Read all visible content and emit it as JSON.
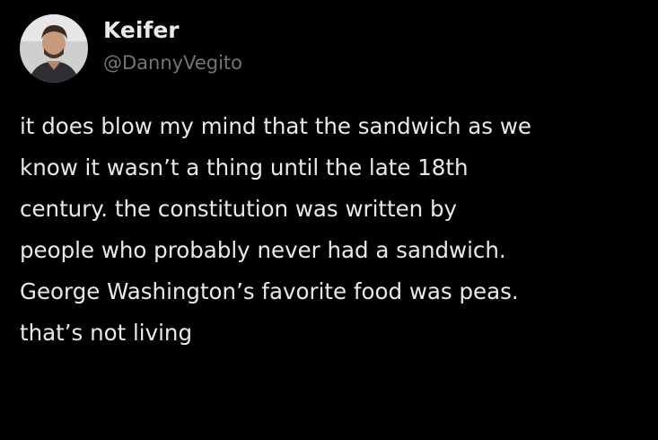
{
  "author": {
    "display_name": "Keifer",
    "handle": "@DannyVegito",
    "avatar_icon": "profile-photo"
  },
  "tweet": {
    "text": "it does blow my mind that the sandwich as we\nknow it wasn’t a thing until the late 18th\ncentury. the constitution was written by\npeople who probably never had a sandwich.\nGeorge Washington’s favorite food was peas.\nthat’s not living"
  },
  "colors": {
    "background": "#000000",
    "primary_text": "#e7e9ea",
    "secondary_text": "#71767b"
  }
}
